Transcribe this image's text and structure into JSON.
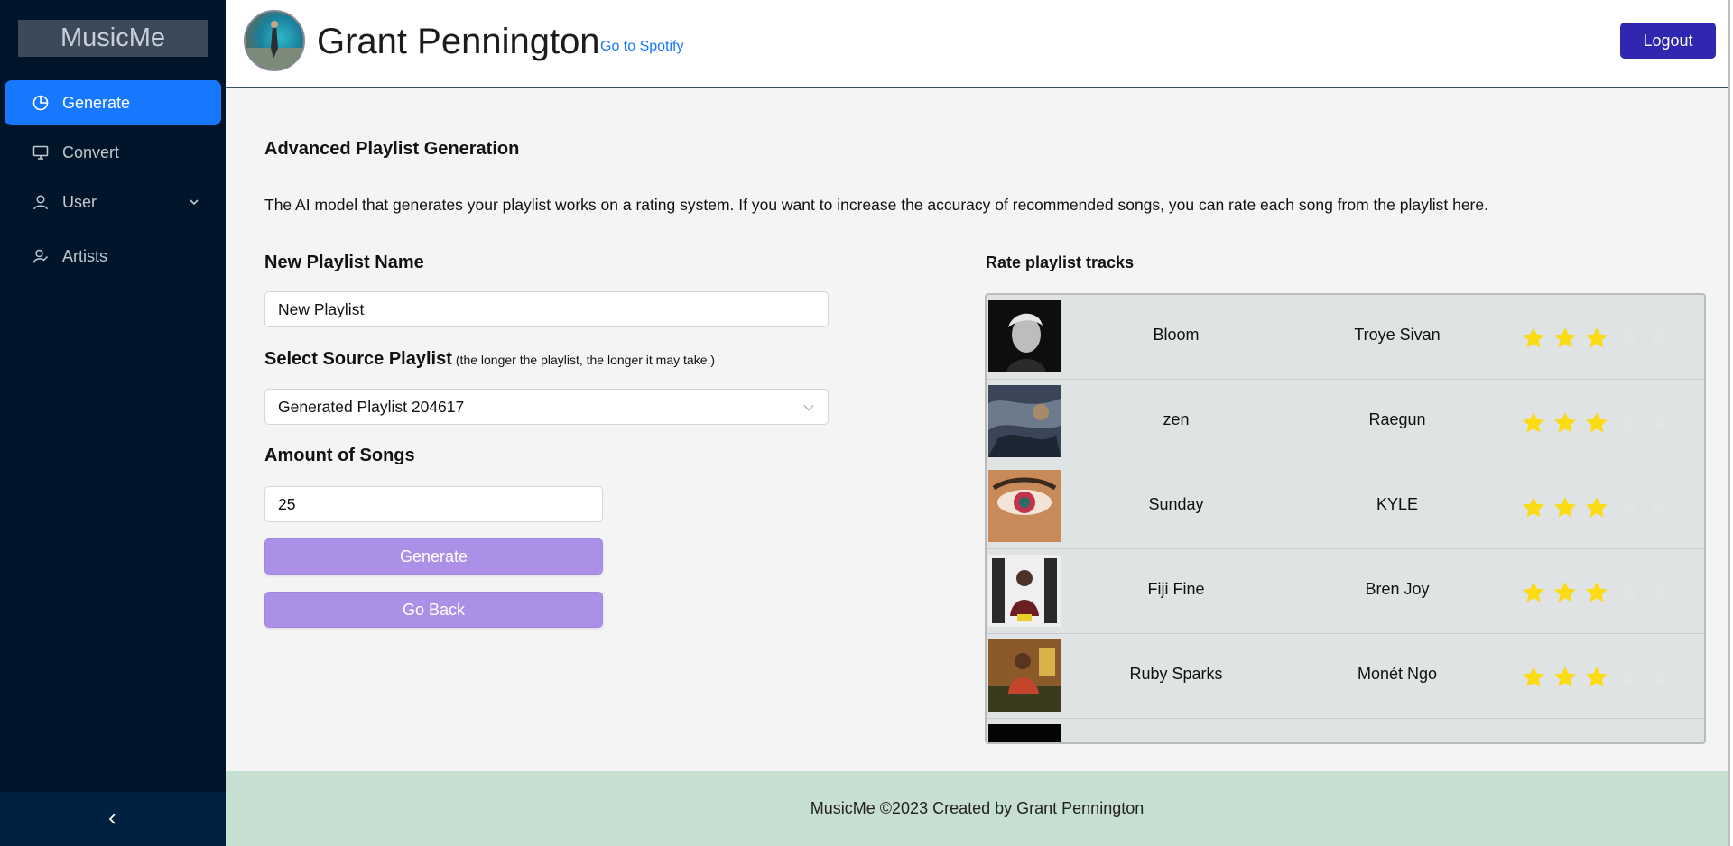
{
  "sidebar": {
    "logo": "MusicMe",
    "items": [
      {
        "label": "Generate",
        "icon": "pie-chart-icon",
        "active": true
      },
      {
        "label": "Convert",
        "icon": "desktop-icon"
      },
      {
        "label": "User",
        "icon": "user-icon",
        "has_submenu": true
      },
      {
        "label": "Artists",
        "icon": "artist-icon"
      }
    ],
    "collapse_icon": "chevron-left-icon"
  },
  "header": {
    "user_name": "Grant Pennington",
    "spotify_link": "Go to Spotify",
    "logout_label": "Logout"
  },
  "main": {
    "title": "Advanced Playlist Generation",
    "description": "The AI model that generates your playlist works on a rating system. If you want to increase the accuracy of recommended songs, you can rate each song from the playlist here.",
    "playlist_name_label": "New Playlist Name",
    "playlist_name_value": "New Playlist",
    "source_label": "Select Source Playlist",
    "source_hint": "(the longer the playlist, the longer it may take.)",
    "source_value": "Generated Playlist 204617",
    "amount_label": "Amount of Songs",
    "amount_value": "25",
    "generate_label": "Generate",
    "back_label": "Go Back"
  },
  "rating": {
    "title": "Rate playlist tracks",
    "max_stars": 5,
    "tracks": [
      {
        "name": "Bloom",
        "artist": "Troye Sivan",
        "rating": 3
      },
      {
        "name": "zen",
        "artist": "Raegun",
        "rating": 3
      },
      {
        "name": "Sunday",
        "artist": "KYLE",
        "rating": 3
      },
      {
        "name": "Fiji Fine",
        "artist": "Bren Joy",
        "rating": 3
      },
      {
        "name": "Ruby Sparks",
        "artist": "Monét Ngo",
        "rating": 3
      }
    ]
  },
  "footer": {
    "text": "MusicMe ©2023 Created by Grant Pennington"
  },
  "colors": {
    "sidebar_bg": "#001529",
    "active_item": "#1677ff",
    "logout_bg": "#2f27b0",
    "button_purple": "#ac90e8",
    "star_filled": "#fadb14",
    "star_empty": "#e3e5e5",
    "footer_bg": "#c6dfd1"
  }
}
